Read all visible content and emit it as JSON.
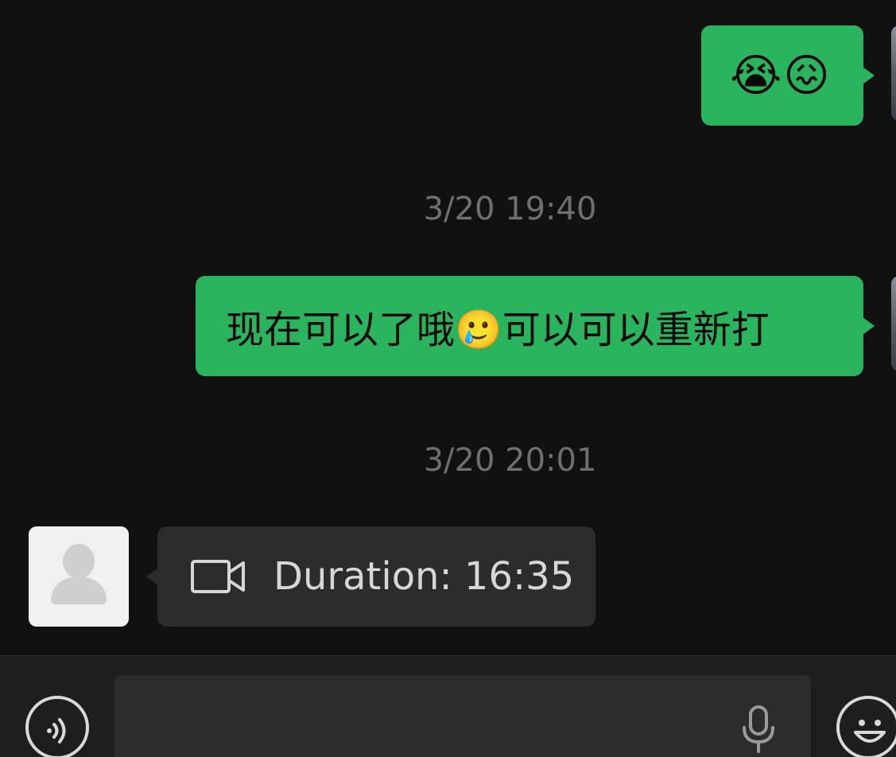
{
  "chat": {
    "messages": [
      {
        "id": "m1",
        "direction": "outgoing",
        "text": "😭😖"
      },
      {
        "id": "ts1",
        "type": "timestamp",
        "text": "3/20 19:40"
      },
      {
        "id": "m2",
        "direction": "outgoing",
        "text": "现在可以了哦🥲可以可以重新打"
      },
      {
        "id": "ts2",
        "type": "timestamp",
        "text": "3/20 20:01"
      },
      {
        "id": "m3",
        "direction": "incoming",
        "type": "video-call",
        "icon": "video-camera-icon",
        "text": "Duration: 16:35"
      }
    ]
  },
  "input_bar": {
    "placeholder": "",
    "value": "",
    "voice_icon": "voice-mode-icon",
    "mic_icon": "microphone-icon",
    "emoji_icon": "emoji-icon"
  },
  "colors": {
    "background": "#111111",
    "outgoing_bubble": "#2bb45e",
    "incoming_bubble": "#2c2c2c",
    "timestamp_text": "#6f6f6f"
  }
}
